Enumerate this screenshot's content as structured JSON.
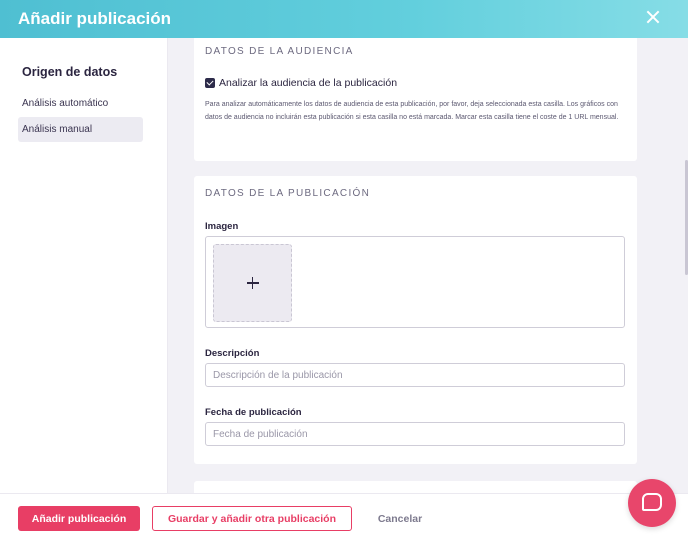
{
  "modal": {
    "title": "Añadir publicación"
  },
  "sidebar": {
    "title": "Origen de datos",
    "items": [
      {
        "label": "Análisis automático",
        "active": false
      },
      {
        "label": "Análisis manual",
        "active": true
      }
    ]
  },
  "audience": {
    "section_title": "DATOS DE LA AUDIENCIA",
    "checkbox_label": "Analizar la audiencia de la publicación",
    "checked": true,
    "help_text": "Para analizar automáticamente los datos de audiencia de esta publicación, por favor, deja seleccionada esta casilla. Los gráficos con datos de audiencia no incluirán esta publicación si esta casilla no está marcada. Marcar esta casilla tiene el coste de 1 URL mensual."
  },
  "publication": {
    "section_title": "DATOS DE LA PUBLICACIÓN",
    "image_label": "Imagen",
    "description_label": "Descripción",
    "description_placeholder": "Descripción de la publicación",
    "description_value": "",
    "date_label": "Fecha de publicación",
    "date_placeholder": "Fecha de publicación",
    "date_value": ""
  },
  "footer": {
    "add_label": "Añadir publicación",
    "save_add_another_label": "Guardar y añadir otra publicación",
    "cancel_label": "Cancelar"
  },
  "icons": {
    "close": "close-icon",
    "checkbox": "check-icon",
    "add_image": "plus-icon",
    "chat": "help-chat-icon"
  },
  "colors": {
    "header_gradient_start": "#4fbfd2",
    "header_gradient_end": "#86dde6",
    "primary": "#e83e65",
    "text_dark": "#2b2540",
    "background": "#f2f1f6"
  }
}
